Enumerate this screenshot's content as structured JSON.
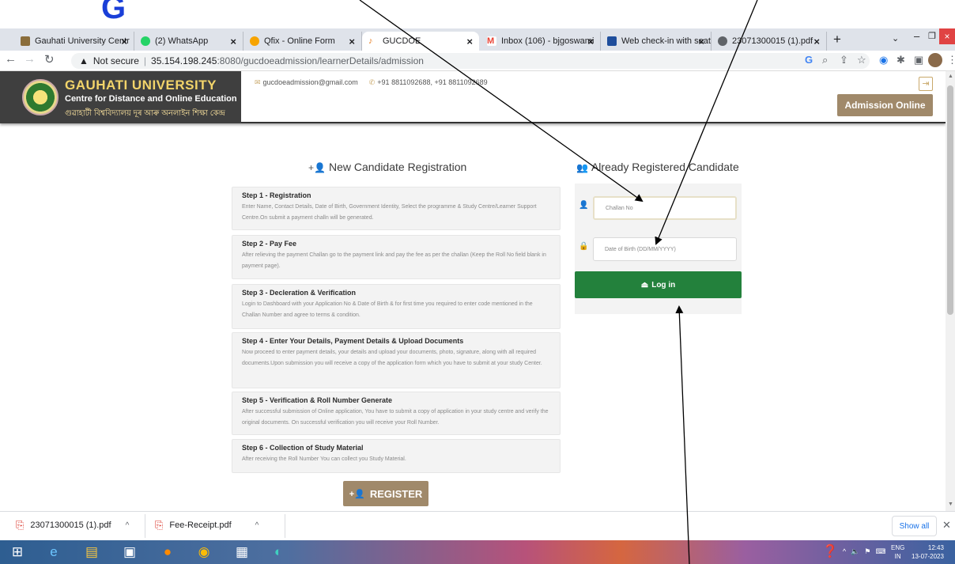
{
  "browser": {
    "tabs": [
      {
        "title": "Gauhati University Centr",
        "active": false
      },
      {
        "title": "(2) WhatsApp",
        "active": false
      },
      {
        "title": "Qfix - Online Form",
        "active": false
      },
      {
        "title": "GUCDOE",
        "active": true
      },
      {
        "title": "Inbox (106) - bjgoswami",
        "active": false
      },
      {
        "title": "Web check-in with seat s",
        "active": false
      },
      {
        "title": "23071300015 (1).pdf",
        "active": false
      }
    ],
    "security_label": "Not secure",
    "url_host": "35.154.198.245",
    "url_path": ":8080/gucdoeadmission/learnerDetails/admission"
  },
  "site": {
    "university_name": "GAUHATI UNIVERSITY",
    "centre_name": "Centre for Distance and Online Education",
    "local_name": "গুৱাহাটী বিশ্ববিদ্যালয় দূৰ আৰু অনলাইন শিক্ষা কেন্দ্ৰ",
    "email": "gucdoeadmission@gmail.com",
    "phones": "+91 8811092688, +91 8811092689",
    "admission_button": "Admission Online"
  },
  "main": {
    "new_heading": "New Candidate Registration",
    "already_heading": "Already Registered Candidate",
    "steps": [
      {
        "title": "Step 1 - Registration",
        "desc": "Enter Name, Contact Details, Date of Birth, Government Identity, Select the programme & Study Centre/Learner Support Centre.On submit a payment challn will be generated."
      },
      {
        "title": "Step 2 - Pay Fee",
        "desc": "After relieving the payment Challan go to the payment link and pay the fee as per the challan (Keep the Roll No field blank in payment page)."
      },
      {
        "title": "Step 3 - Decleration & Verification",
        "desc": "Login to Dashboard with your Application No & Date of Birth & for first time you required to enter code mentioned in the Challan Number and agree to terms & condition."
      },
      {
        "title": "Step 4 - Enter Your Details, Payment Details & Upload Documents",
        "desc": "Now proceed to enter payment details, your details and upload your documents, photo, signature, along with all required documents.Upon submission you will receive a copy of the application form which you have to submit at your study Center."
      },
      {
        "title": "Step 5 - Verification & Roll Number Generate",
        "desc": "After successful submission of Online application, You have to submit a copy of application in your study centre and verify the original documents. On successful verification you will receive your Roll Number."
      },
      {
        "title": "Step 6 - Collection of Study Material",
        "desc": "After receiving the Roll Number You can collect you Study Material."
      }
    ],
    "register_button": "REGISTER",
    "login": {
      "challan_placeholder": "Challan No",
      "dob_placeholder": "Date of Birth (DD/MM/YYYY)",
      "login_button": "Log in"
    }
  },
  "downloads": {
    "items": [
      "23071300015 (1).pdf",
      "Fee-Receipt.pdf"
    ],
    "show_all": "Show all"
  },
  "taskbar": {
    "lang_line1": "ENG",
    "lang_line2": "IN",
    "time": "12:43",
    "date": "13-07-2023"
  },
  "colors": {
    "brand_gold": "#a0896a",
    "login_green": "#23813c",
    "header_dark": "#3f3f3f"
  }
}
